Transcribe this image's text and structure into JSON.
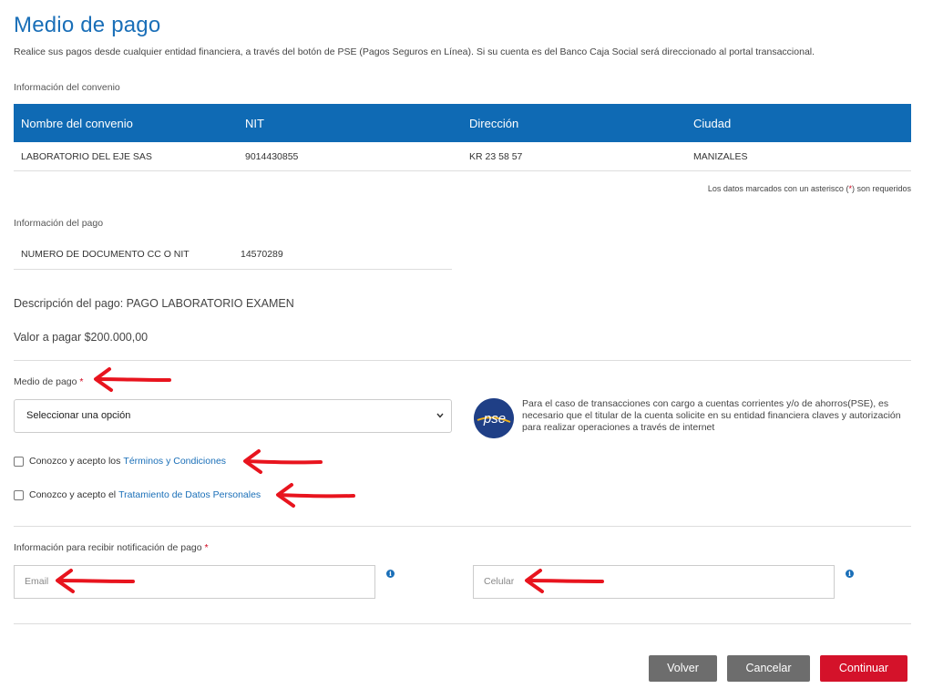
{
  "header": {
    "title": "Medio de pago",
    "intro": "Realice sus pagos desde cualquier entidad financiera, a través del botón de PSE (Pagos Seguros en Línea). Si su cuenta es del Banco Caja Social será direccionado al portal transaccional."
  },
  "convenio": {
    "label": "Información del convenio",
    "columns": [
      "Nombre del convenio",
      "NIT",
      "Dirección",
      "Ciudad"
    ],
    "row": [
      "LABORATORIO DEL EJE SAS",
      "9014430855",
      "KR 23 58 57",
      "MANIZALES"
    ]
  },
  "required_note": {
    "before": "Los datos marcados con un asterisco (",
    "mark": "*",
    "after": ") son requeridos"
  },
  "pago": {
    "label": "Información del pago",
    "doc_label": "NUMERO DE DOCUMENTO CC O NIT",
    "doc_value": "14570289",
    "descripcion": "Descripción del pago: PAGO LABORATORIO EXAMEN",
    "valor": "Valor a pagar $200.000,00"
  },
  "medio": {
    "label": "Medio de pago",
    "asterisk": "*",
    "select_value": "Seleccionar una opción",
    "pse_logo_text": "pse",
    "pse_text": "Para el caso de transacciones con cargo a cuentas corrientes y/o de ahorros(PSE), es necesario que el titular de la cuenta solicite en su entidad financiera claves y autorización para realizar operaciones a través de internet"
  },
  "terms": {
    "text": "Conozco y acepto los",
    "link": "Términos y Condiciones",
    "checked": false
  },
  "datos": {
    "text": "Conozco y acepto el",
    "link": "Tratamiento de Datos Personales",
    "checked": false
  },
  "notificacion": {
    "label": "Información para recibir notificación de pago",
    "asterisk": "*",
    "email_placeholder": "Email",
    "celular_placeholder": "Celular",
    "info_glyph": "i"
  },
  "buttons": {
    "volver": "Volver",
    "cancelar": "Cancelar",
    "continuar": "Continuar"
  },
  "colors": {
    "primary": "#1a6fb8",
    "table_header": "#0f6ab4",
    "secondary_button": "#6d6d6d",
    "continue_button": "#d4122a",
    "annotation_arrow": "#e8141e"
  },
  "icons": [
    "chevron-down-icon",
    "pse-logo",
    "info-icon",
    "red-arrow-annotation"
  ]
}
